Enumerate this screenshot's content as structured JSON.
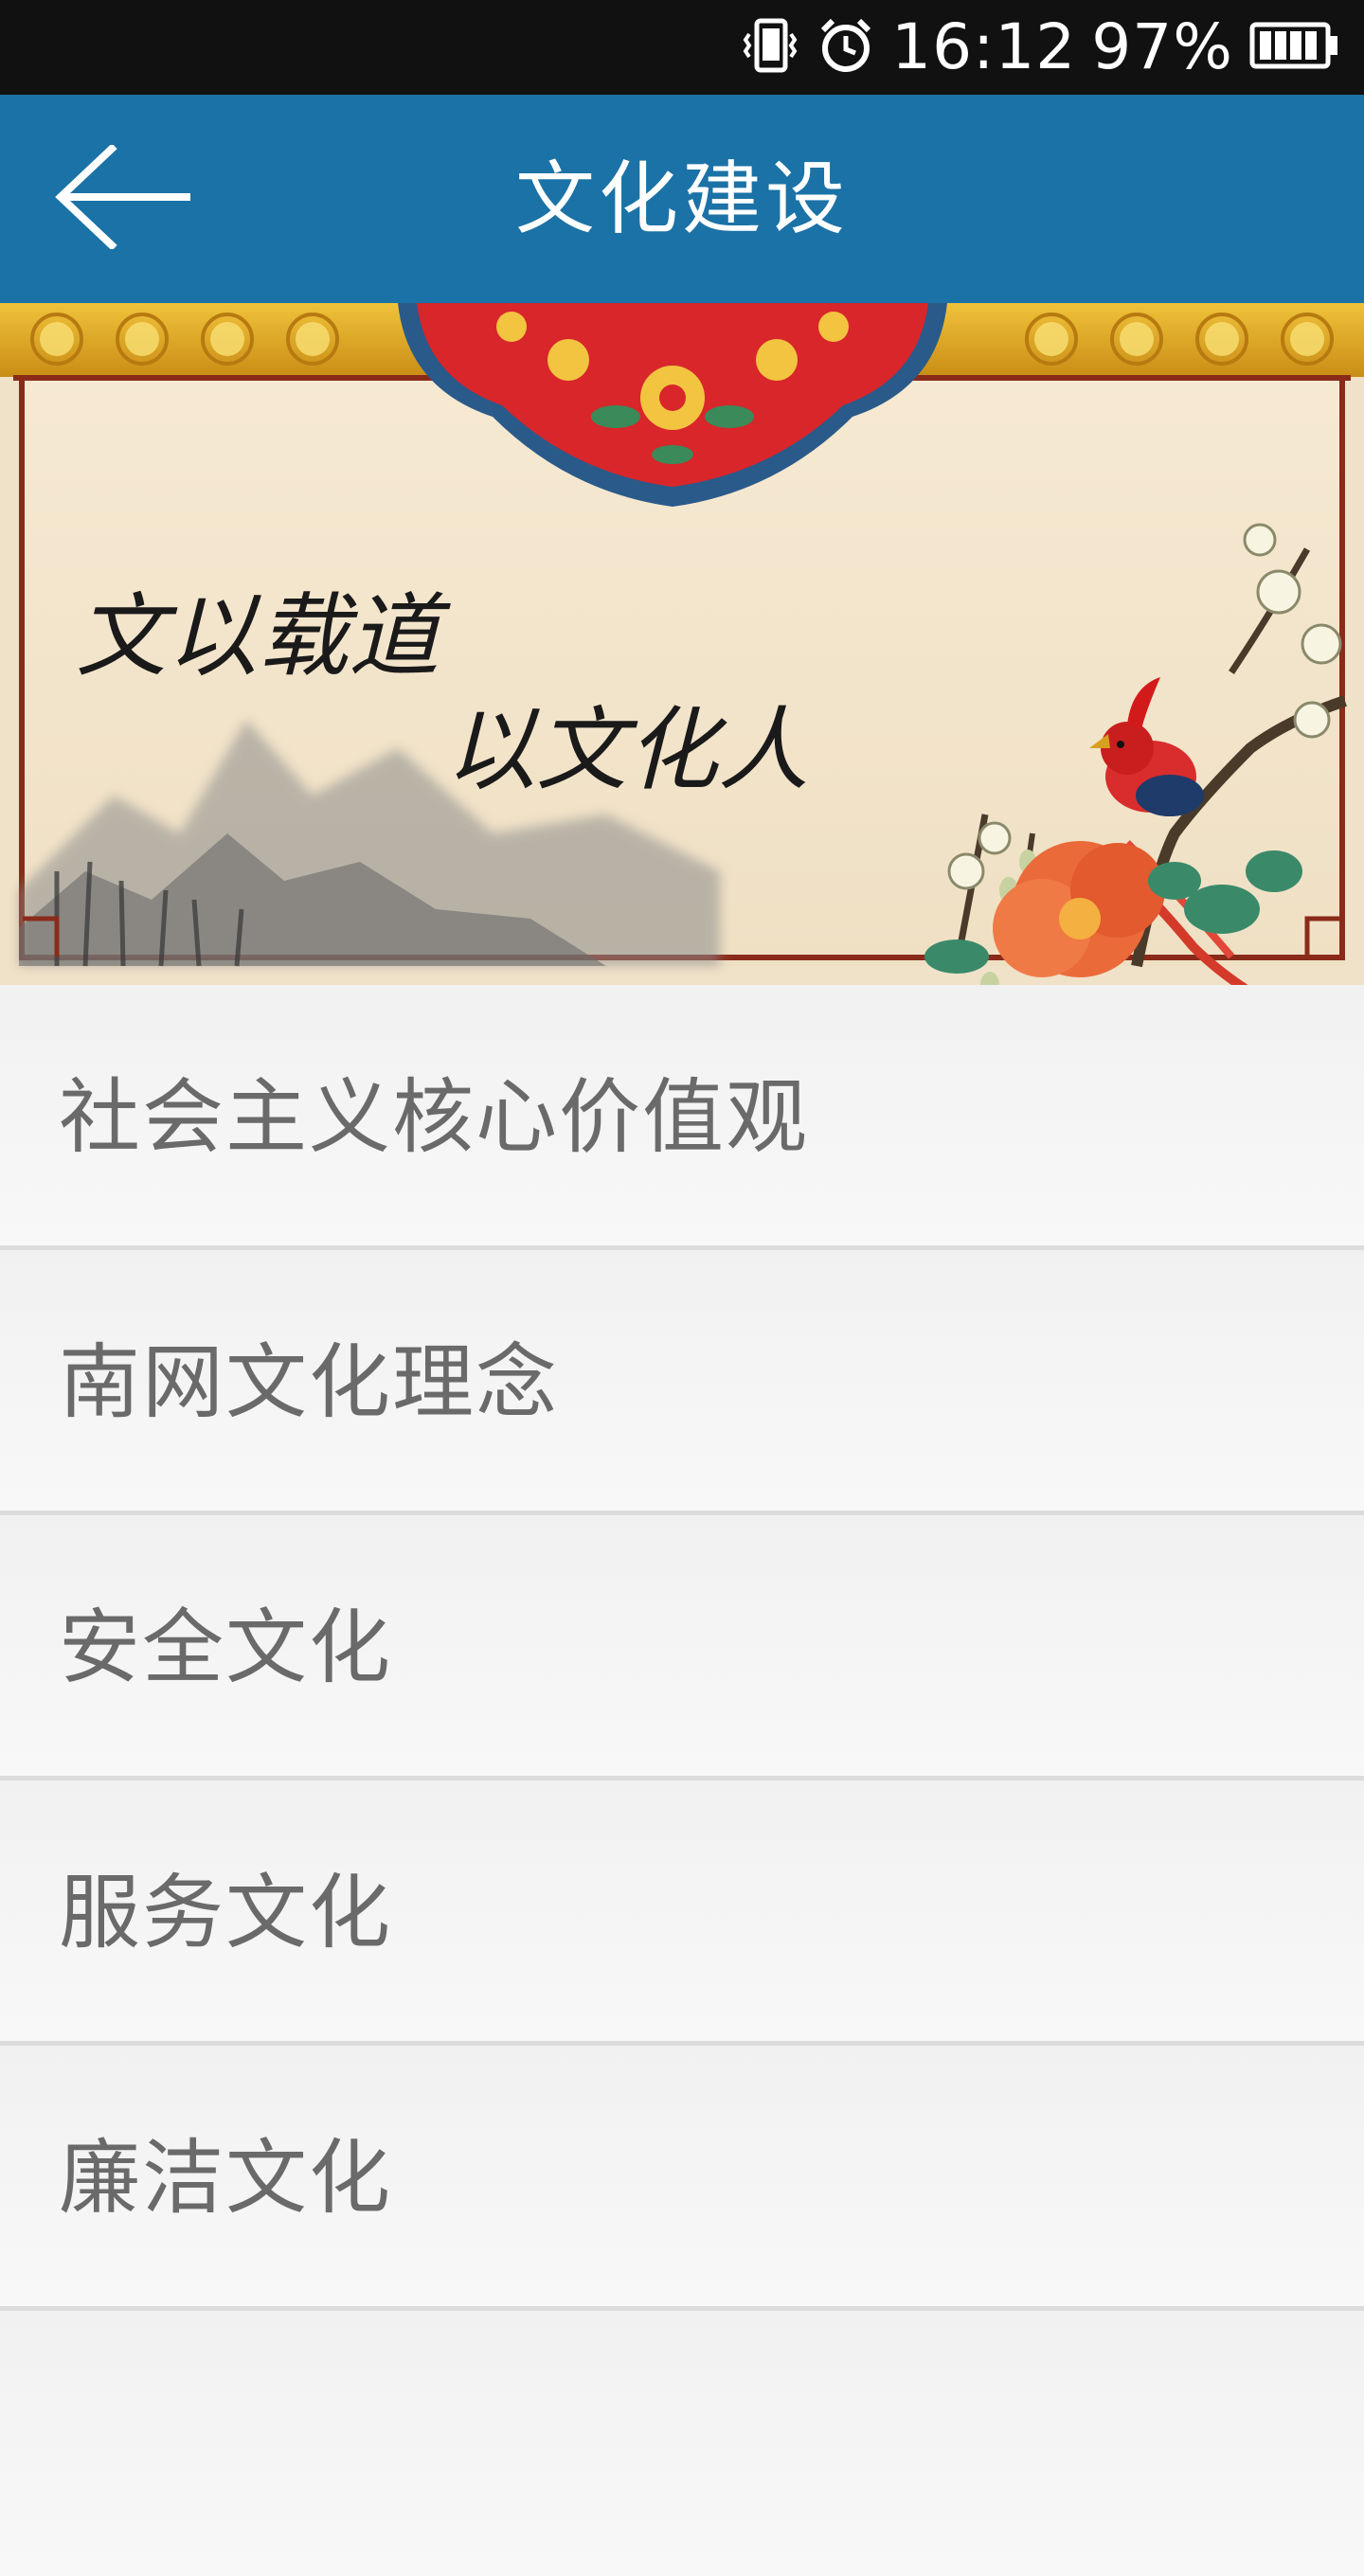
{
  "status_bar": {
    "time": "16:12",
    "battery": "97%",
    "icons": [
      "vibrate-icon",
      "alarm-icon",
      "battery-icon"
    ]
  },
  "app_bar": {
    "title": "文化建设",
    "back_icon": "back-arrow-icon",
    "color": "#1b72a6"
  },
  "banner": {
    "line1": "文以载道",
    "line2": "以文化人"
  },
  "menu": {
    "items": [
      {
        "label": "社会主义核心价值观"
      },
      {
        "label": "南网文化理念"
      },
      {
        "label": "安全文化"
      },
      {
        "label": "服务文化"
      },
      {
        "label": "廉洁文化"
      },
      {
        "label": ""
      }
    ]
  }
}
